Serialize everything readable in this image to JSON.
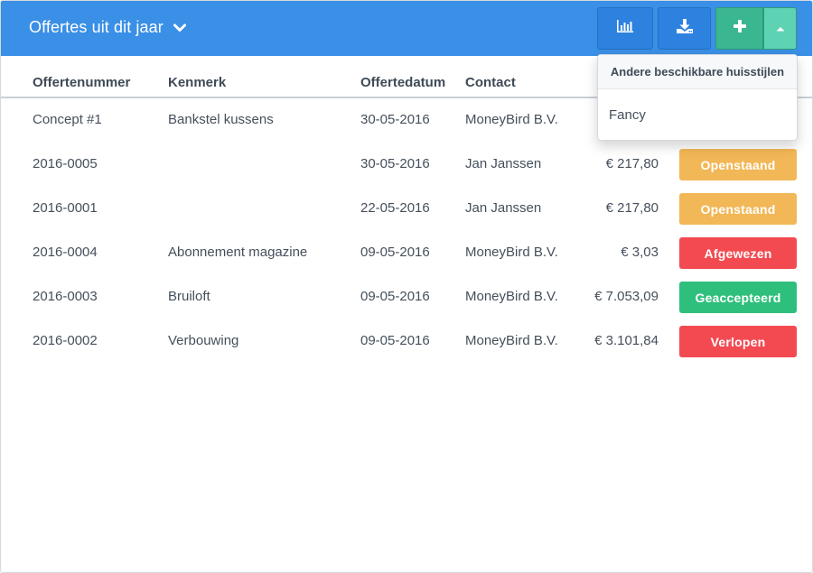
{
  "header": {
    "title": "Offertes uit dit jaar",
    "title_icon": "chevron-down-icon",
    "buttons": {
      "stats_icon": "bar-chart-icon",
      "download_icon": "download-icon",
      "add_icon": "plus-icon",
      "toggle_icon": "caret-up-icon"
    }
  },
  "table": {
    "columns": [
      "Offertenummer",
      "Kenmerk",
      "Offertedatum",
      "Contact"
    ],
    "rows": [
      {
        "number": "Concept #1",
        "reference": "Bankstel kussens",
        "date": "30-05-2016",
        "contact": "MoneyBird B.V.",
        "amount": "",
        "status": ""
      },
      {
        "number": "2016-0005",
        "reference": "",
        "date": "30-05-2016",
        "contact": "Jan Janssen",
        "amount": "€ 217,80",
        "status": "Openstaand"
      },
      {
        "number": "2016-0001",
        "reference": "",
        "date": "22-05-2016",
        "contact": "Jan Janssen",
        "amount": "€ 217,80",
        "status": "Openstaand"
      },
      {
        "number": "2016-0004",
        "reference": "Abonnement magazine",
        "date": "09-05-2016",
        "contact": "MoneyBird B.V.",
        "amount": "€ 3,03",
        "status": "Afgewezen"
      },
      {
        "number": "2016-0003",
        "reference": "Bruiloft",
        "date": "09-05-2016",
        "contact": "MoneyBird B.V.",
        "amount": "€ 7.053,09",
        "status": "Geaccepteerd"
      },
      {
        "number": "2016-0002",
        "reference": "Verbouwing",
        "date": "09-05-2016",
        "contact": "MoneyBird B.V.",
        "amount": "€ 3.101,84",
        "status": "Verlopen"
      }
    ]
  },
  "status_colors": {
    "Openstaand": "#f2b756",
    "Afgewezen": "#f34a52",
    "Geaccepteerd": "#2fbf7c",
    "Verlopen": "#f34a52"
  },
  "dropdown": {
    "header": "Andere beschikbare huisstijlen",
    "items": [
      "Fancy"
    ]
  },
  "colors": {
    "topbar": "#3a8fe6",
    "primary_button": "#2d82df",
    "add_button": "#3ab791",
    "toggle_button": "#5ed3b3"
  }
}
